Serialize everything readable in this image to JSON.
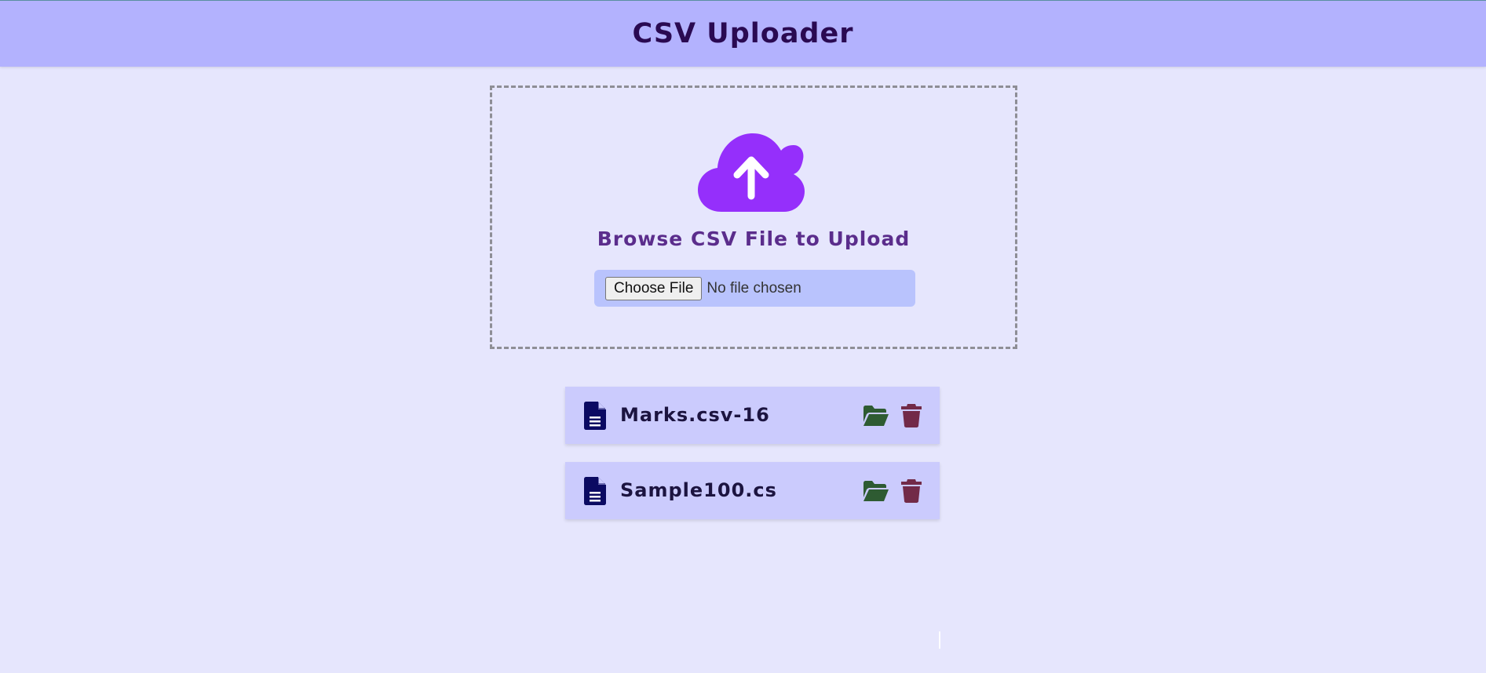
{
  "header": {
    "title": "CSV Uploader"
  },
  "upload": {
    "icon": "cloud-upload-icon",
    "title": "Browse CSV File to Upload",
    "choose_button_label": "Choose File",
    "file_status": "No file chosen"
  },
  "files": [
    {
      "name": "Marks.csv-16",
      "icon": "file-document-icon",
      "open_icon": "folder-open-icon",
      "delete_icon": "trash-icon"
    },
    {
      "name": "Sample100.cs",
      "icon": "file-document-icon",
      "open_icon": "folder-open-icon",
      "delete_icon": "trash-icon"
    }
  ],
  "colors": {
    "header_bg": "#b3b2fe",
    "page_bg": "#e6e6fd",
    "accent_purple": "#952ffb",
    "file_row_bg": "#cbcbfd",
    "open_icon": "#2e5b32",
    "delete_icon": "#722a48",
    "doc_icon": "#0b0a62"
  }
}
